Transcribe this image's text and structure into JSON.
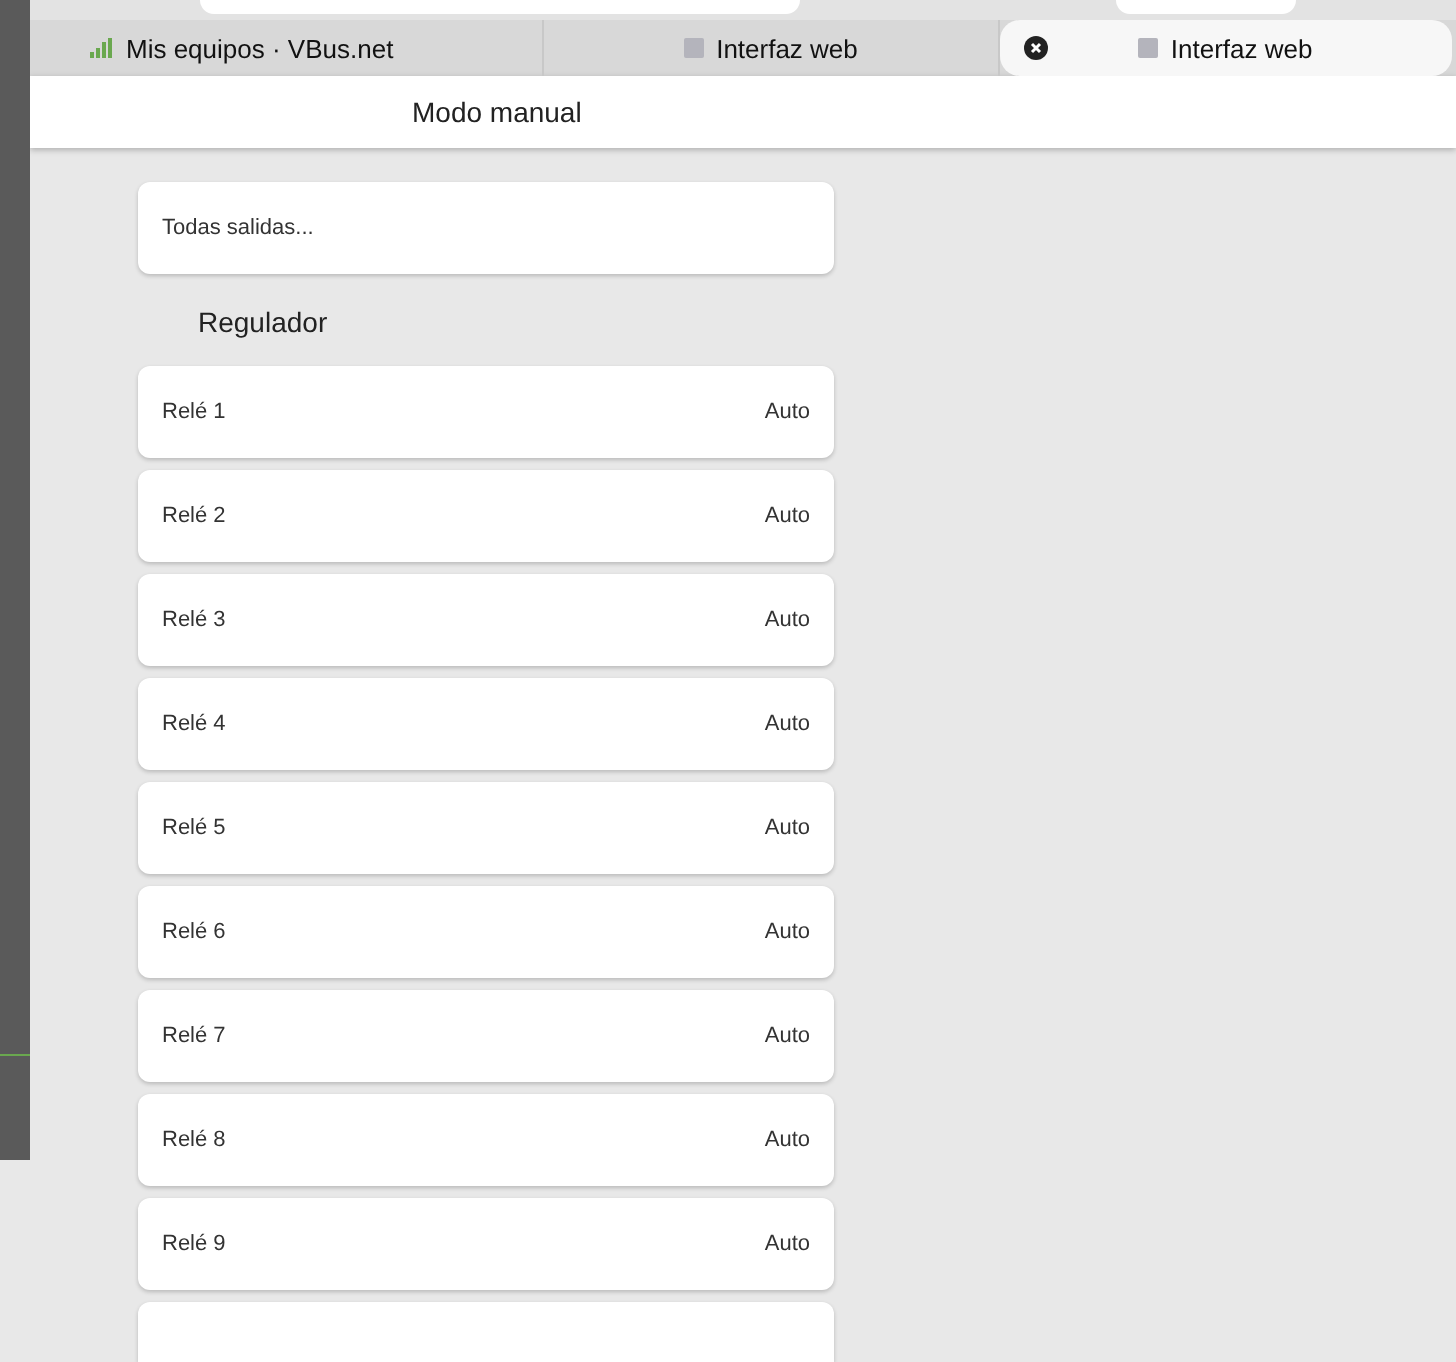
{
  "tabs": [
    {
      "label": "Mis equipos · VBus.net",
      "kind": "devices",
      "selected": false
    },
    {
      "label": "Interfaz web",
      "kind": "site",
      "selected": false
    },
    {
      "label": "Interfaz web",
      "kind": "site",
      "selected": true
    }
  ],
  "header": {
    "title": "Modo manual"
  },
  "all_outputs": {
    "label": "Todas salidas..."
  },
  "section": {
    "title": "Regulador"
  },
  "relays": [
    {
      "name": "Relé 1",
      "mode": "Auto"
    },
    {
      "name": "Relé 2",
      "mode": "Auto"
    },
    {
      "name": "Relé 3",
      "mode": "Auto"
    },
    {
      "name": "Relé 4",
      "mode": "Auto"
    },
    {
      "name": "Relé 5",
      "mode": "Auto"
    },
    {
      "name": "Relé 6",
      "mode": "Auto"
    },
    {
      "name": "Relé 7",
      "mode": "Auto"
    },
    {
      "name": "Relé 8",
      "mode": "Auto"
    },
    {
      "name": "Relé 9",
      "mode": "Auto"
    }
  ]
}
